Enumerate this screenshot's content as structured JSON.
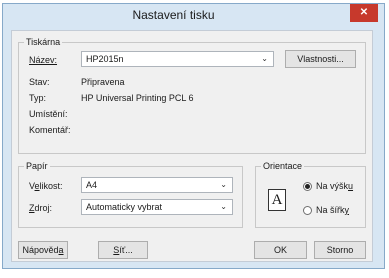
{
  "dialog": {
    "title": "Nastavení tisku",
    "close_icon": "close-icon"
  },
  "printer": {
    "group_label": "Tiskárna",
    "name_label": "Název:",
    "name_value": "HP2015n",
    "properties_button": "Vlastnosti...",
    "status_label": "Stav:",
    "status_value": "Připravena",
    "type_label": "Typ:",
    "type_value": "HP Universal Printing PCL 6",
    "location_label": "Umístění:",
    "location_value": "",
    "comment_label": "Komentář:",
    "comment_value": ""
  },
  "paper": {
    "group_label": "Papír",
    "size_label": "Velikost:",
    "size_value": "A4",
    "source_label": "Zdroj:",
    "source_value": "Automaticky vybrat"
  },
  "orientation": {
    "group_label": "Orientace",
    "icon": "portrait-page-icon",
    "icon_letter": "A",
    "portrait_label": "Na výšku",
    "landscape_label": "Na šířku",
    "selected": "portrait"
  },
  "buttons": {
    "help": "Nápověda",
    "network": "Síť...",
    "ok": "OK",
    "cancel": "Storno"
  },
  "colors": {
    "frame": "#d7e6f3",
    "close": "#c7392c"
  }
}
